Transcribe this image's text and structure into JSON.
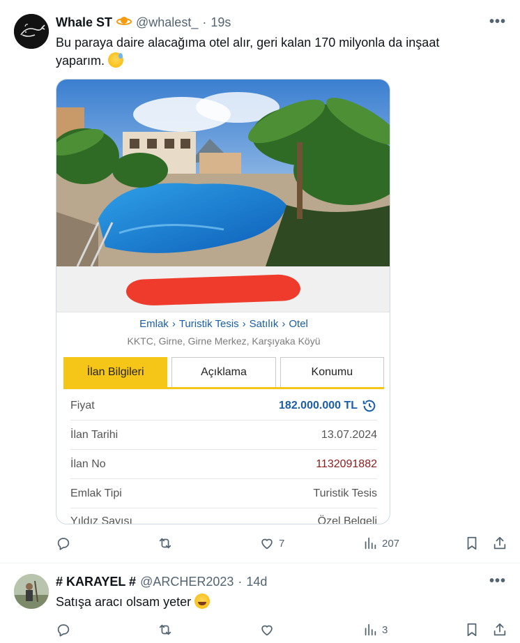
{
  "tweets": [
    {
      "display_name": "Whale ST",
      "handle": "@whalest_",
      "separator": "·",
      "time": "19s",
      "text": "Bu paraya daire alacağıma otel alır, geri kalan 170 milyonla da inşaat yaparım.",
      "emoji": "sweat-smile-emoji",
      "listing": {
        "breadcrumb": [
          "Emlak",
          "Turistik Tesis",
          "Satılık",
          "Otel"
        ],
        "breadcrumb_sep": "›",
        "location": "KKTC, Girne, Girne Merkez, Karşıyaka Köyü",
        "tabs": [
          "İlan Bilgileri",
          "Açıklama",
          "Konumu"
        ],
        "rows": [
          {
            "key": "Fiyat",
            "value": "182.000.000 TL"
          },
          {
            "key": "İlan Tarihi",
            "value": "13.07.2024"
          },
          {
            "key": "İlan No",
            "value": "1132091882"
          },
          {
            "key": "Emlak Tipi",
            "value": "Turistik Tesis"
          },
          {
            "key": "Yıldız Sayısı",
            "value": "Özel Belgeli"
          }
        ]
      },
      "stats": {
        "replies": "",
        "reposts": "",
        "likes": "7",
        "views": "207"
      }
    },
    {
      "display_name": "# KARAYEL #",
      "handle": "@ARCHER2023",
      "separator": "·",
      "time": "14d",
      "text": "Satışa aracı olsam yeter",
      "emoji": "joy-emoji",
      "stats": {
        "replies": "",
        "reposts": "",
        "likes": "",
        "views": "3"
      }
    }
  ],
  "colors": {
    "accent_blue": "#1a5ea8",
    "tab_yellow": "#f5c518",
    "redaction": "#ee3b2b",
    "muted": "#536471"
  }
}
